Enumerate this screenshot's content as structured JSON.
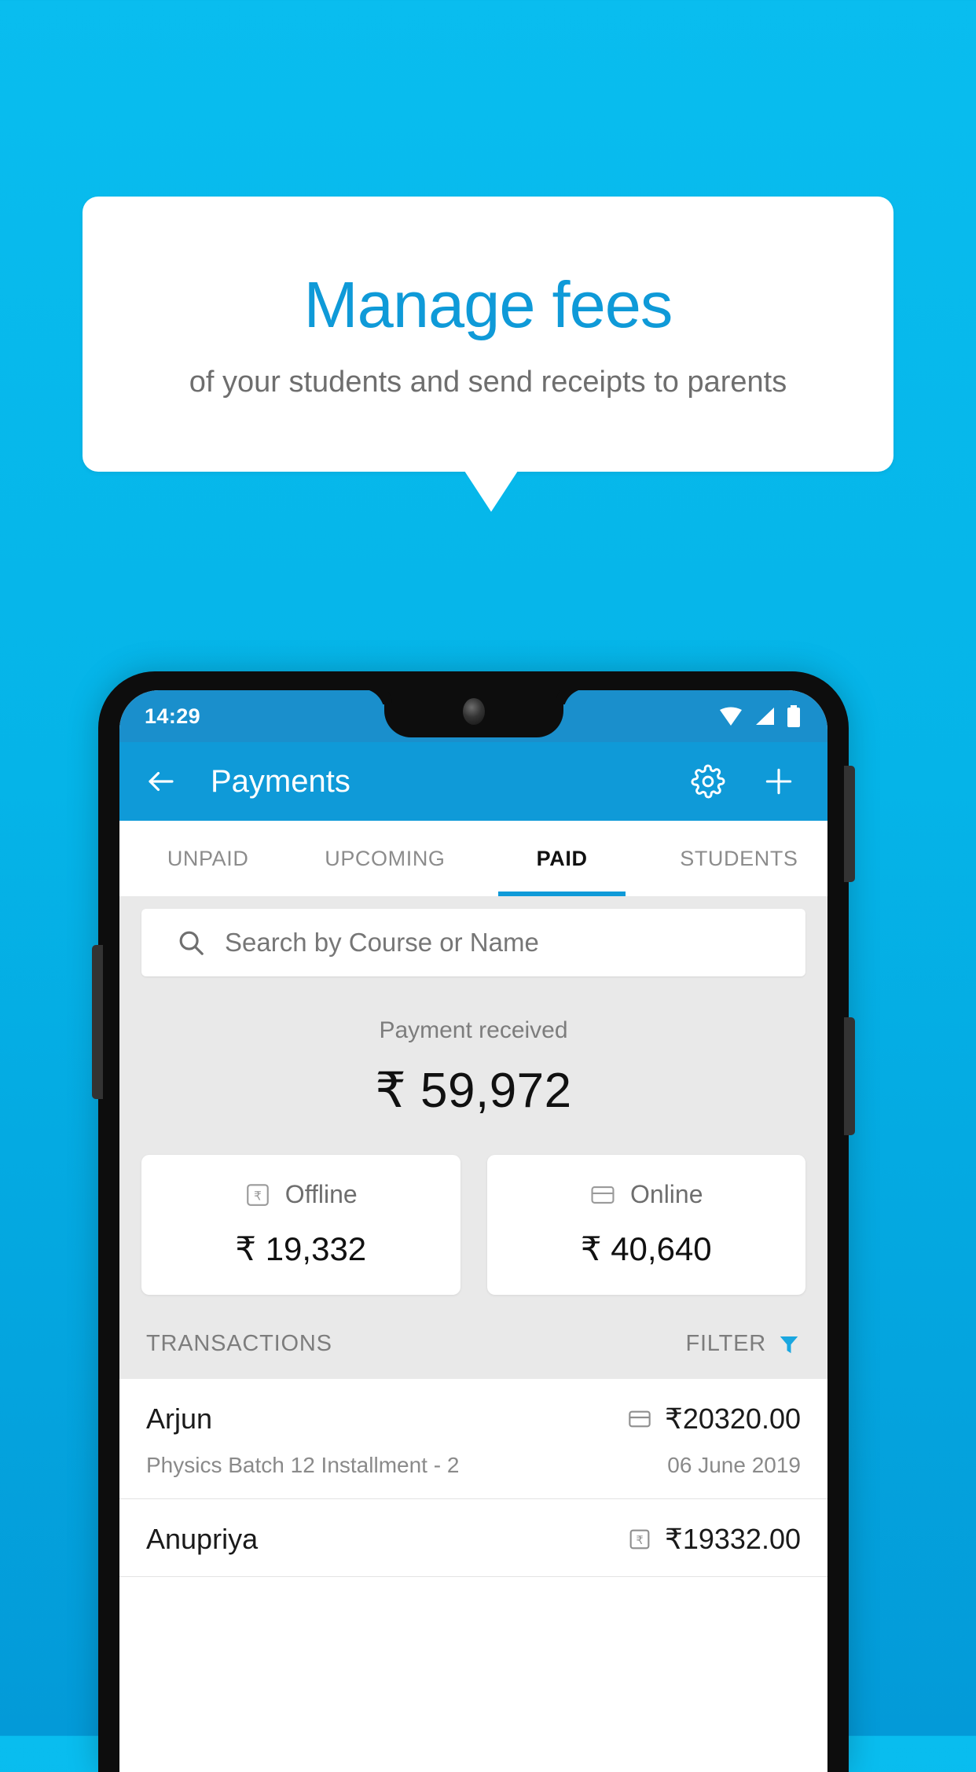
{
  "promo": {
    "title": "Manage fees",
    "subtitle": "of your students and send receipts to parents",
    "title_color": "#0f9ad8",
    "subtitle_color": "#6e6e6e",
    "background_color": "#05b4e8"
  },
  "phone": {
    "statusbar": {
      "time": "14:29",
      "icons": [
        "wifi-icon",
        "signal-icon",
        "battery-icon"
      ],
      "background_color": "#1a8fcc"
    },
    "appbar": {
      "back_icon": "back-arrow-icon",
      "title": "Payments",
      "settings_icon": "gear-icon",
      "add_icon": "plus-icon",
      "background_color": "#0f9ad8"
    },
    "tabs": [
      {
        "label": "UNPAID",
        "active": false
      },
      {
        "label": "UPCOMING",
        "active": false
      },
      {
        "label": "PAID",
        "active": true
      },
      {
        "label": "STUDENTS",
        "active": false
      }
    ],
    "tab_accent_color": "#0f9ad8",
    "search": {
      "icon": "search-icon",
      "placeholder": "Search by Course or Name",
      "value": ""
    },
    "summary": {
      "label": "Payment received",
      "amount": "₹ 59,972"
    },
    "method_cards": [
      {
        "icon": "rupee-box-icon",
        "label": "Offline",
        "amount": "₹ 19,332"
      },
      {
        "icon": "credit-card-icon",
        "label": "Online",
        "amount": "₹ 40,640"
      }
    ],
    "transactions_header": {
      "title": "TRANSACTIONS",
      "filter_label": "FILTER",
      "filter_icon": "funnel-icon",
      "filter_icon_color": "#1aa7e0"
    },
    "transactions": [
      {
        "name": "Arjun",
        "icon": "credit-card-icon",
        "amount": "₹20320.00",
        "description": "Physics Batch 12 Installment - 2",
        "date": "06 June 2019"
      },
      {
        "name": "Anupriya",
        "icon": "rupee-box-icon",
        "amount": "₹19332.00",
        "description": "",
        "date": ""
      }
    ]
  }
}
